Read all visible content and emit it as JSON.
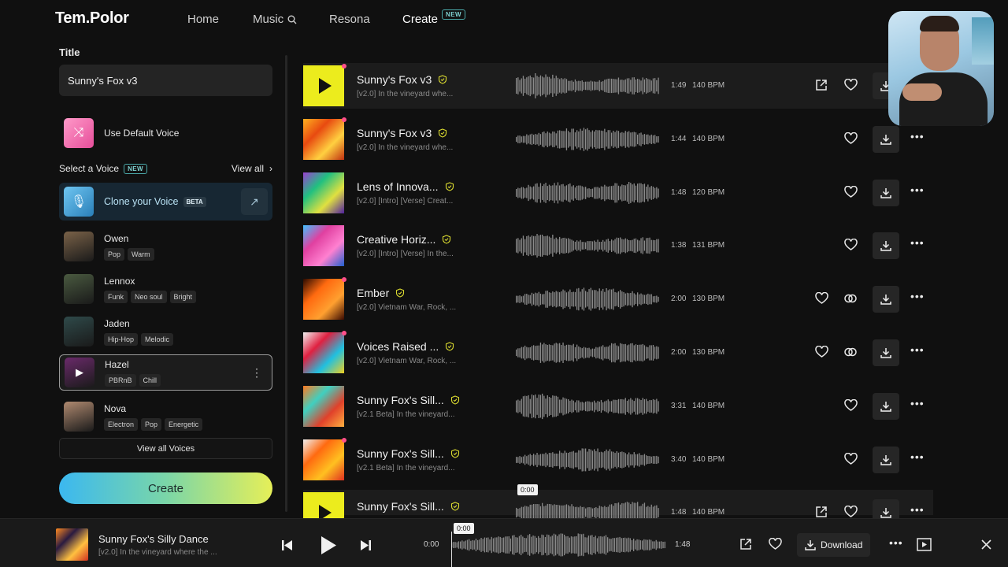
{
  "nav": {
    "logo": "Tem.Polor",
    "home": "Home",
    "music": "Music",
    "resona": "Resona",
    "create": "Create",
    "new_badge": "NEW"
  },
  "form": {
    "title_label": "Title",
    "title_value": "Sunny's Fox v3",
    "default_voice": "Use Default Voice",
    "select_voice": "Select a Voice",
    "select_voice_badge": "NEW",
    "view_all": "View all",
    "clone_voice": "Clone your Voice",
    "clone_badge": "BETA",
    "view_all_voices": "View all Voices",
    "create_button": "Create"
  },
  "voices": [
    {
      "name": "Owen",
      "tags": [
        "Pop",
        "Warm"
      ],
      "color": "#7a6248"
    },
    {
      "name": "Lennox",
      "tags": [
        "Funk",
        "Neo soul",
        "Bright"
      ],
      "color": "#4a5a40"
    },
    {
      "name": "Jaden",
      "tags": [
        "Hip-Hop",
        "Melodic"
      ],
      "color": "#2f4a4a"
    },
    {
      "name": "Hazel",
      "tags": [
        "PBRnB",
        "Chill"
      ],
      "color": "#6a2a6a",
      "selected": true
    },
    {
      "name": "Nova",
      "tags": [
        "Electron",
        "Pop",
        "Energetic"
      ],
      "color": "#b08a70"
    }
  ],
  "tracks": [
    {
      "title": "Sunny's Fox v3",
      "sub": "[v2.0] In the vineyard whe...",
      "dur": "1:49",
      "bpm": "140 BPM",
      "cover": "play",
      "dot": true,
      "share": true
    },
    {
      "title": "Sunny's Fox v3",
      "sub": "[v2.0] In the vineyard whe...",
      "dur": "1:44",
      "bpm": "140 BPM",
      "cover": "linear-gradient(135deg,#ffb020,#e84a10,#ffd040,#c03010)",
      "dot": true
    },
    {
      "title": "Lens of Innova...",
      "sub": "[v2.0] [Intro] [Verse] Creat...",
      "dur": "1:48",
      "bpm": "120 BPM",
      "cover": "linear-gradient(135deg,#9a40d0,#20c080,#e0e040,#5020a0)"
    },
    {
      "title": "Creative Horiz...",
      "sub": "[v2.0] [Intro] [Verse] In the...",
      "dur": "1:38",
      "bpm": "131 BPM",
      "cover": "linear-gradient(135deg,#40c0ff,#e040a0,#ff80d0,#2060d0)"
    },
    {
      "title": "Ember",
      "sub": "[v2.0] Vietnam War, Rock, ...",
      "dur": "2:00",
      "bpm": "130 BPM",
      "cover": "linear-gradient(135deg,#2a0a00,#ff6a10,#ffa030,#3a0a00)",
      "dot": true,
      "link": true
    },
    {
      "title": "Voices Raised ...",
      "sub": "[v2.0] Vietnam War, Rock, ...",
      "dur": "2:00",
      "bpm": "130 BPM",
      "cover": "linear-gradient(135deg,#f0f0f0,#e02040,#20c0e0,#f0d020)",
      "dot": true,
      "link": true
    },
    {
      "title": "Sunny Fox's Sill...",
      "sub": "[v2.1 Beta] In the vineyard...",
      "dur": "3:31",
      "bpm": "140 BPM",
      "cover": "linear-gradient(135deg,#ff7a20,#40d0c0,#e0402a,#ffb040)"
    },
    {
      "title": "Sunny Fox's Sill...",
      "sub": "[v2.1 Beta] In the vineyard...",
      "dur": "3:40",
      "bpm": "140 BPM",
      "cover": "linear-gradient(135deg,#f0f0f0,#ff6a10,#ffc020,#e03020)",
      "dot": true
    },
    {
      "title": "Sunny Fox's Sill...",
      "sub": "",
      "dur": "1:48",
      "bpm": "140 BPM",
      "cover": "play",
      "share": true,
      "time_tip": "0:00"
    }
  ],
  "player": {
    "title": "Sunny Fox's Silly Dance",
    "sub": "[v2.0] In the vineyard where the ...",
    "time_start": "0:00",
    "time_end": "1:48",
    "time_tip": "0:00",
    "download": "Download"
  },
  "colors": {
    "accent_pink": "#ff4f8b",
    "play_yellow": "#ecec1d",
    "verified_yellow": "#dcdc30"
  }
}
